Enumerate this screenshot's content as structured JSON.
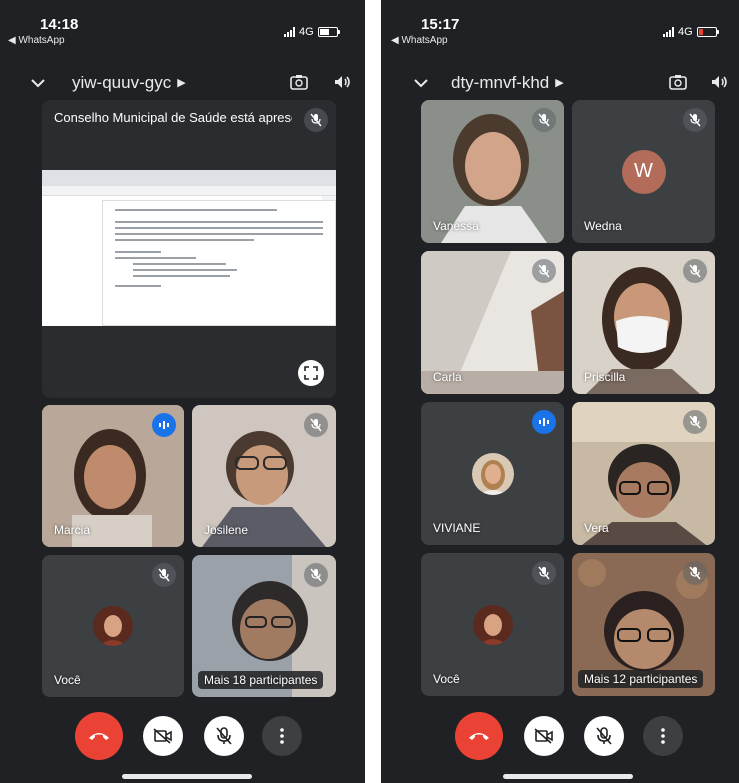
{
  "left": {
    "status": {
      "time": "14:18",
      "back_label": "◀ WhatsApp",
      "network": "4G"
    },
    "meeting_code": "yiw-quuv-gyc",
    "presentation": {
      "title": "Conselho Municipal de Saúde está apresentando"
    },
    "tiles": [
      {
        "name": "Marcia",
        "state": "speaking"
      },
      {
        "name": "Josilene",
        "state": "muted"
      },
      {
        "name": "Você",
        "state": "muted"
      },
      {
        "name": "Mais 18 participantes",
        "state": "muted"
      }
    ]
  },
  "right": {
    "status": {
      "time": "15:17",
      "back_label": "◀ WhatsApp",
      "network": "4G"
    },
    "meeting_code": "dty-mnvf-khd",
    "tiles": [
      {
        "name": "Vanessa",
        "state": "muted"
      },
      {
        "name": "Wedna",
        "state": "muted",
        "initial": "W"
      },
      {
        "name": "Carla",
        "state": "muted"
      },
      {
        "name": "Priscilla",
        "state": "muted"
      },
      {
        "name": "VIVIANE",
        "state": "speaking"
      },
      {
        "name": "Vera",
        "state": "muted"
      },
      {
        "name": "Você",
        "state": "muted"
      },
      {
        "name": "Mais 12 participantes",
        "state": "muted"
      }
    ]
  },
  "colors": {
    "background": "#202124",
    "tile": "#3c4043",
    "end_call": "#ea4335",
    "speaking": "#1a73e8",
    "battery_low": "#ea4335"
  },
  "icons": [
    "chevron-down-icon",
    "camera-switch-icon",
    "speaker-icon",
    "mic-off-icon",
    "speaking-indicator-icon",
    "fullscreen-icon",
    "end-call-icon",
    "camera-off-icon",
    "more-options-icon"
  ]
}
